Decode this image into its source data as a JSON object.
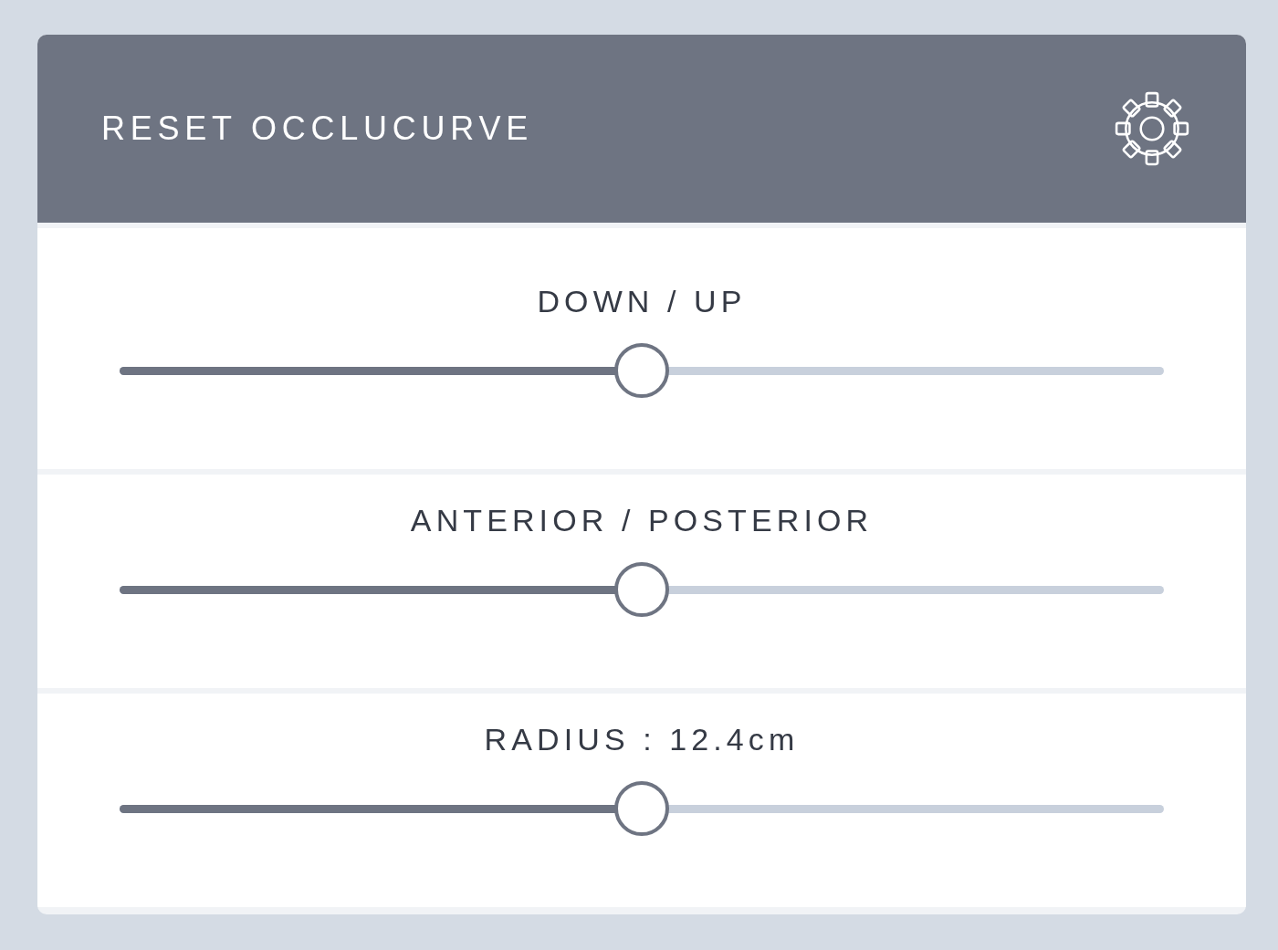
{
  "panel": {
    "title": "RESET OCCLUCURVE"
  },
  "sliders": [
    {
      "label": "DOWN / UP",
      "level": 0.5
    },
    {
      "label": "ANTERIOR / POSTERIOR",
      "level": 0.5
    },
    {
      "label": "RADIUS : 12.4cm",
      "level": 0.5
    }
  ]
}
